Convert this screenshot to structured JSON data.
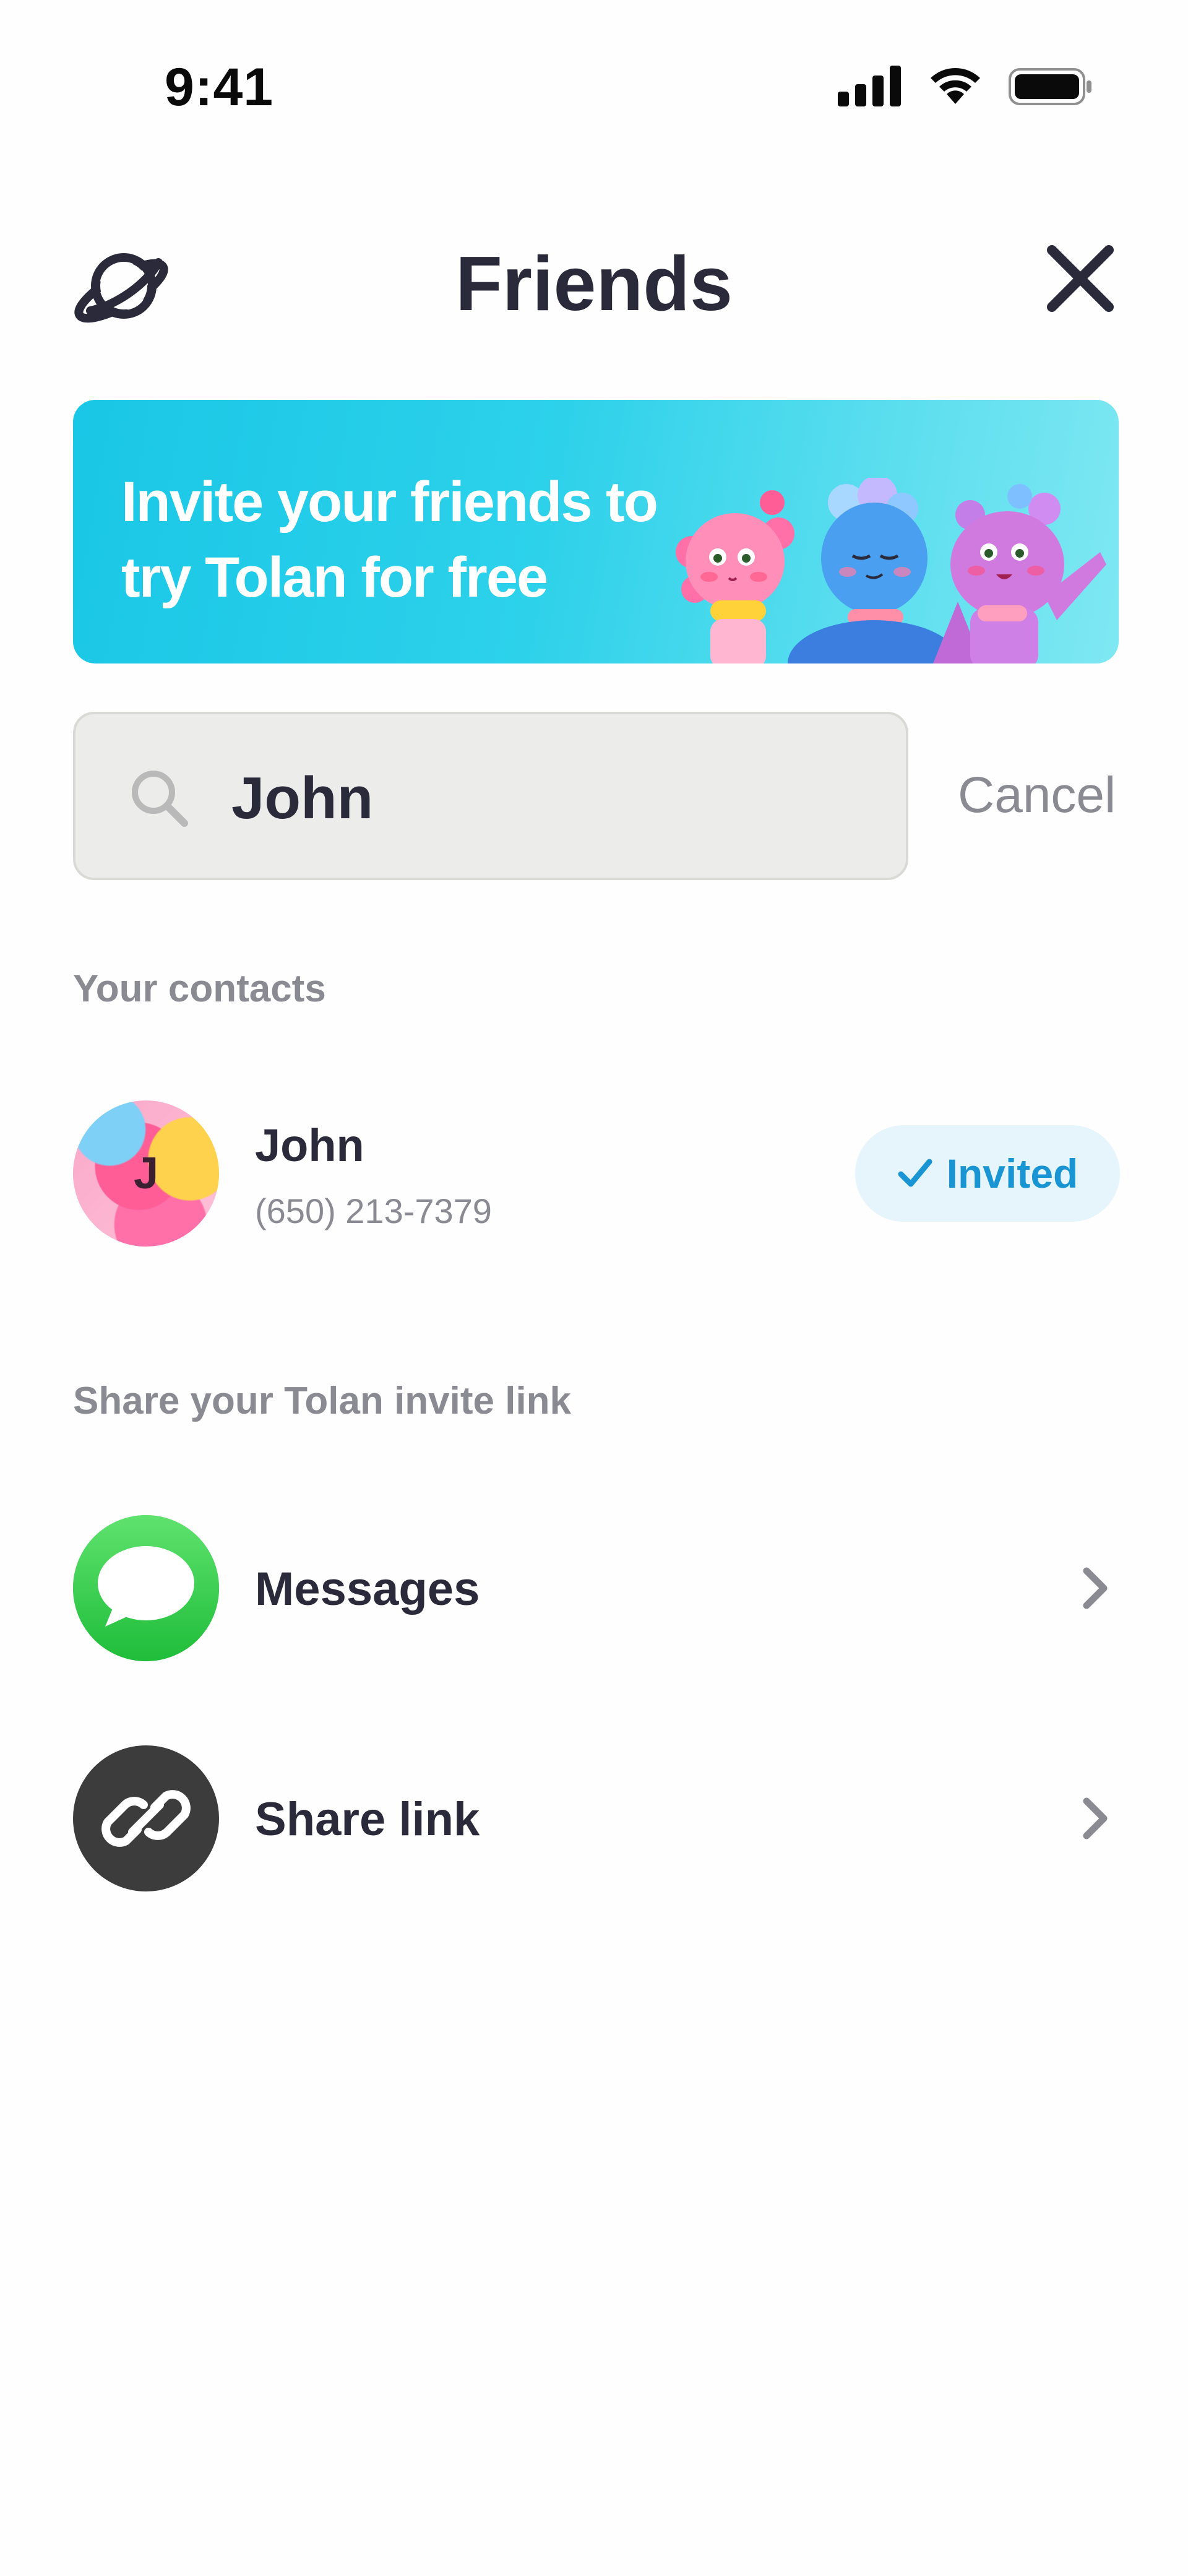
{
  "status_bar": {
    "time": "9:41",
    "icons": [
      "cellular-signal-icon",
      "wifi-icon",
      "battery-icon"
    ]
  },
  "header": {
    "title": "Friends",
    "left_icon": "planet-icon",
    "right_icon": "close-icon"
  },
  "banner": {
    "line1": "Invite your friends to",
    "line2": "try Tolan for free"
  },
  "search": {
    "value": "John",
    "cancel_label": "Cancel"
  },
  "contacts": {
    "section_title": "Your contacts",
    "items": [
      {
        "initial": "J",
        "name": "John",
        "phone": "(650) 213-7379",
        "status": "Invited"
      }
    ]
  },
  "share": {
    "section_title": "Share your Tolan invite link",
    "items": [
      {
        "label": "Messages",
        "icon": "messages-icon"
      },
      {
        "label": "Share link",
        "icon": "link-icon"
      }
    ]
  },
  "colors": {
    "banner_start": "#19c7e6",
    "banner_end": "#7fe8f2",
    "invited_bg": "#e6f5fb",
    "invited_text": "#1a95d4",
    "messages_green": "#35cf4b",
    "link_dark": "#3c3c3c"
  }
}
